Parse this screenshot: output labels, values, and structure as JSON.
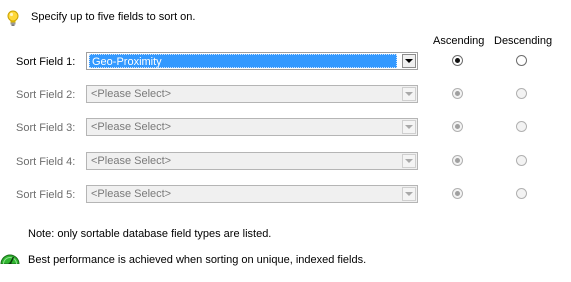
{
  "header": {
    "hint": "Specify up to five fields to sort on.",
    "hint_icon": "lightbulb-icon"
  },
  "columns": {
    "ascending": "Ascending",
    "descending": "Descending"
  },
  "rows": [
    {
      "label": "Sort Field 1:",
      "value": "Geo-Proximity",
      "enabled": true,
      "order": "ascending"
    },
    {
      "label": "Sort Field 2:",
      "value": "<Please Select>",
      "enabled": false,
      "order": "ascending"
    },
    {
      "label": "Sort Field 3:",
      "value": "<Please Select>",
      "enabled": false,
      "order": "ascending"
    },
    {
      "label": "Sort Field 4:",
      "value": "<Please Select>",
      "enabled": false,
      "order": "ascending"
    },
    {
      "label": "Sort Field 5:",
      "value": "<Please Select>",
      "enabled": false,
      "order": "ascending"
    }
  ],
  "footer": {
    "note": "Note: only sortable database field types are listed.",
    "performance": "Best performance is achieved when sorting on unique, indexed fields.",
    "performance_icon": "speedometer-icon"
  },
  "colors": {
    "selection": "#3399ff",
    "gauge": "#2fb52f",
    "bulb": "#ffd83a"
  }
}
